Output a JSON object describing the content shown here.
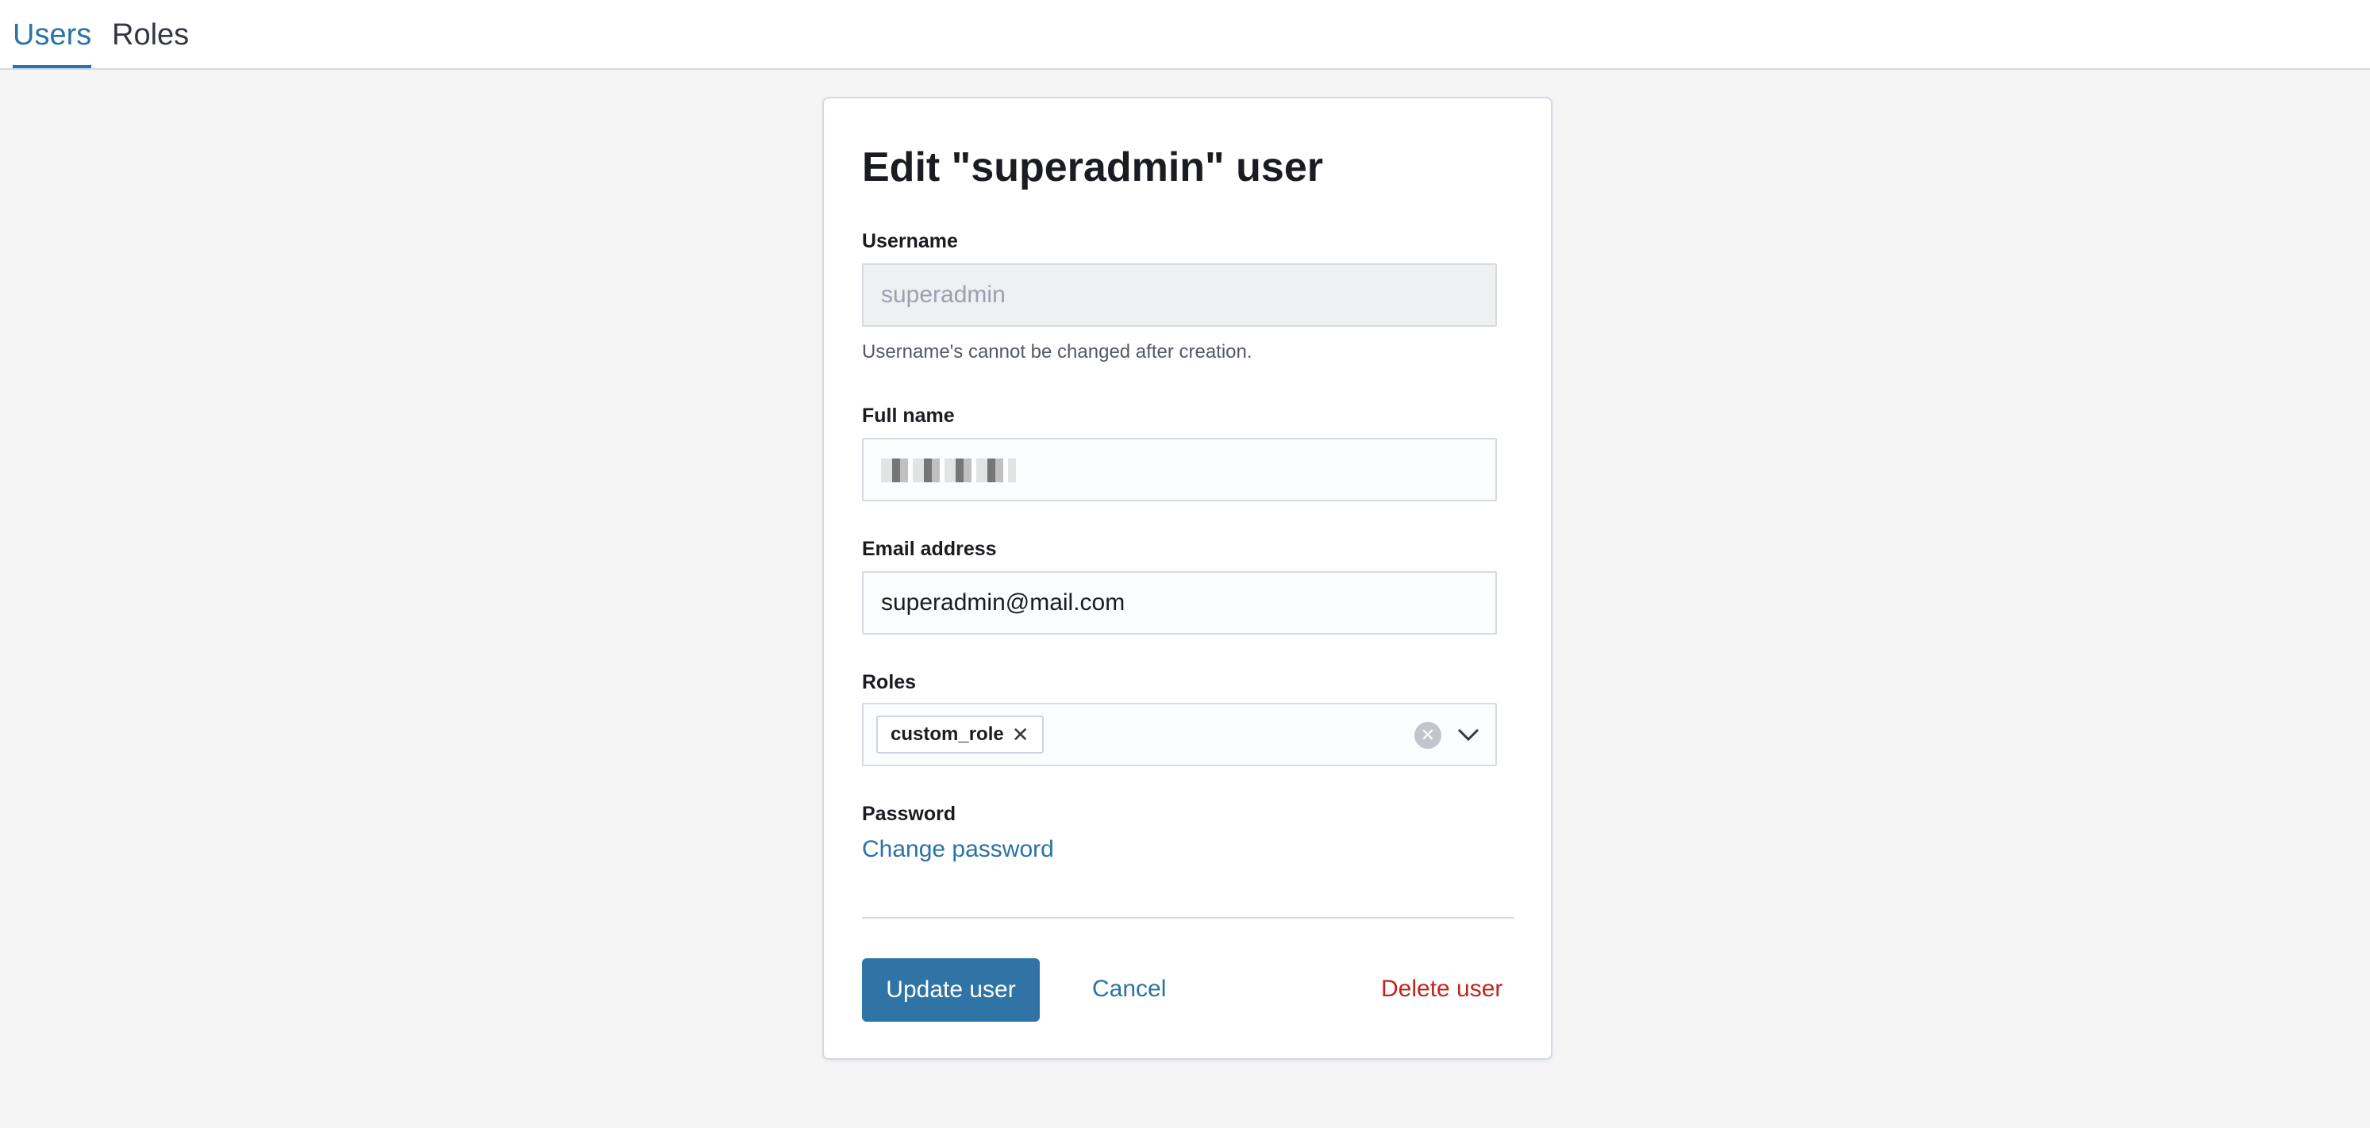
{
  "tabs": [
    {
      "label": "Users",
      "active": true
    },
    {
      "label": "Roles",
      "active": false
    }
  ],
  "form": {
    "title": "Edit \"superadmin\" user",
    "username": {
      "label": "Username",
      "value": "superadmin",
      "help": "Username's cannot be changed after creation."
    },
    "full_name": {
      "label": "Full name"
    },
    "email": {
      "label": "Email address",
      "value": "superadmin@mail.com"
    },
    "roles": {
      "label": "Roles",
      "selected": [
        "custom_role"
      ],
      "clear_icon": "clear-circle-icon",
      "dropdown_icon": "chevron-down-icon"
    },
    "password": {
      "label": "Password",
      "link": "Change password"
    },
    "actions": {
      "update": "Update user",
      "cancel": "Cancel",
      "delete": "Delete user"
    }
  },
  "colors": {
    "accent": "#2a73a6",
    "primary_button": "#2f74a4",
    "danger": "#bd271e",
    "background": "#f5f5f5"
  }
}
